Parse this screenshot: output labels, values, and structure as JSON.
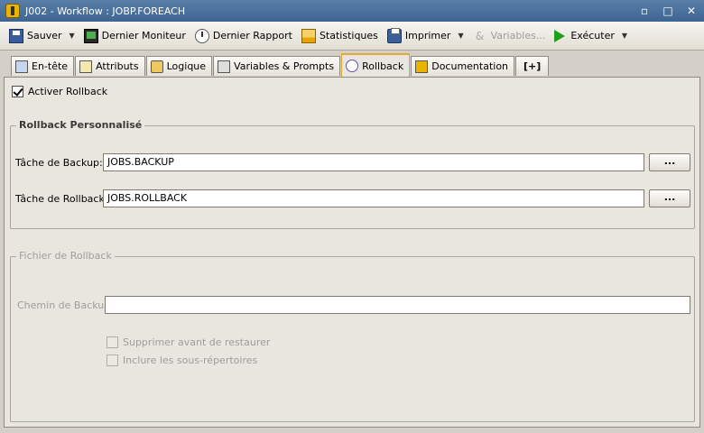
{
  "window": {
    "title": "J002 - Workflow : JOBP.FOREACH",
    "minimize": "▫",
    "maximize": "□",
    "close": "✕"
  },
  "toolbar": {
    "save": "Sauver",
    "last_monitor": "Dernier Moniteur",
    "last_report": "Dernier Rapport",
    "statistics": "Statistiques",
    "print": "Imprimer",
    "variables": "Variables...",
    "execute": "Exécuter",
    "dropdown_arrow": "▼"
  },
  "tabs": [
    {
      "label": "En-tête",
      "icon": "header-icon"
    },
    {
      "label": "Attributs",
      "icon": "attributes-icon"
    },
    {
      "label": "Logique",
      "icon": "logic-icon"
    },
    {
      "label": "Variables & Prompts",
      "icon": "variables-icon"
    },
    {
      "label": "Rollback",
      "icon": "rollback-icon",
      "active": true
    },
    {
      "label": "Documentation",
      "icon": "documentation-icon"
    },
    {
      "label": "[+]",
      "icon": "add-tab-icon"
    }
  ],
  "rollback": {
    "enable_label": "Activer Rollback",
    "enable_checked": true,
    "custom_group": {
      "legend": "Rollback Personnalisé",
      "backup_label": "Tâche de Backup:",
      "backup_value": "JOBS.BACKUP",
      "rollback_label": "Tâche de Rollback:",
      "rollback_value": "JOBS.ROLLBACK",
      "browse_label": "..."
    },
    "file_group": {
      "legend": "Fichier de Rollback",
      "path_label": "Chemin de Backup:",
      "path_value": "",
      "delete_before_restore": "Supprimer avant de restaurer",
      "include_subdirs": "Inclure les sous-répertoires"
    }
  }
}
